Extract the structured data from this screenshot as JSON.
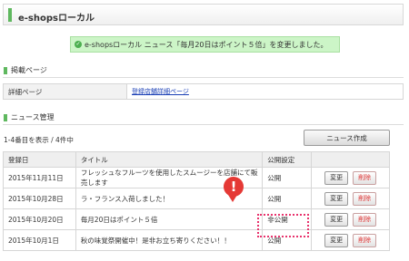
{
  "header": {
    "title": "e-shopsローカル"
  },
  "notice": {
    "text": "e-shopsローカル ニュース「毎月20日はポイント５倍」を変更しました。"
  },
  "published_section": {
    "title": "掲載ページ",
    "label": "詳細ページ",
    "link": "登録店舗詳細ページ"
  },
  "news_section": {
    "title": "ニュース管理",
    "count": "1-4番目を表示 / 4件中",
    "create_button": "ニュース作成",
    "columns": [
      "登録日",
      "タイトル",
      "公開設定",
      ""
    ],
    "rows": [
      {
        "date": "2015年11月11日",
        "title": "フレッシュなフルーツを使用したスムージーを店舗にて販売します",
        "status": "公開"
      },
      {
        "date": "2015年10月28日",
        "title": "ラ・フランス入荷しました！",
        "status": "公開"
      },
      {
        "date": "2015年10月20日",
        "title": "毎月20日はポイント５倍",
        "status": "非公開"
      },
      {
        "date": "2015年10月1日",
        "title": "秋の味覚祭開催中！是非お立ち寄りください！！",
        "status": "公開"
      }
    ],
    "edit_label": "変更",
    "delete_label": "削除"
  },
  "callout": {
    "symbol": "!"
  }
}
